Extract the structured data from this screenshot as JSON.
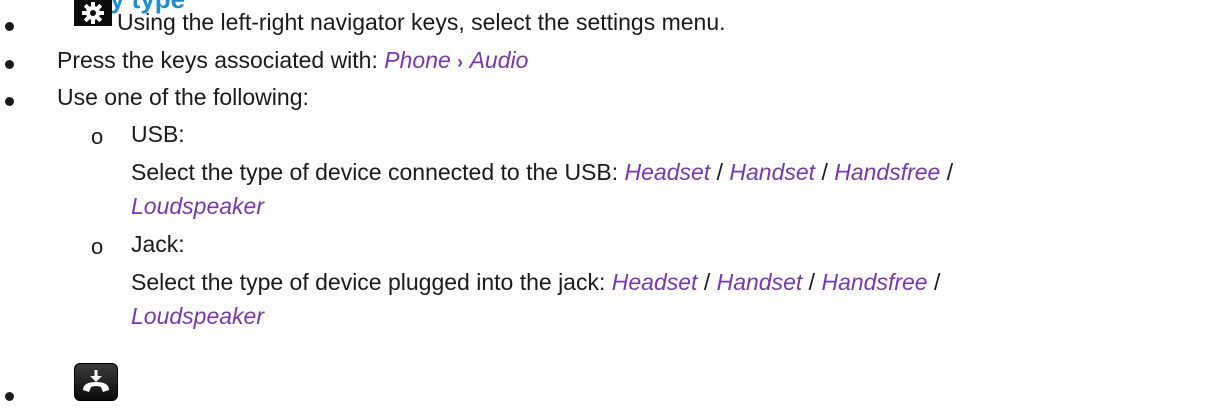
{
  "heading_fragment": "y type",
  "steps": [
    {
      "text": "Using the left-right navigator keys, select the settings menu.",
      "icon": "settings-gear-key-icon"
    },
    {
      "prefix": "Press the keys associated with:",
      "path": [
        "Phone",
        "Audio"
      ],
      "separator": "›"
    },
    {
      "text": "Use one of the following:"
    }
  ],
  "options": [
    {
      "label": "USB:",
      "description": "Select the type of device connected to the USB:",
      "devices": [
        "Headset",
        "Handset",
        "Handsfree",
        "Loudspeaker"
      ]
    },
    {
      "label": "Jack:",
      "description": "Select the type of device plugged into the jack:",
      "devices": [
        "Headset",
        "Handset",
        "Handsfree",
        "Loudspeaker"
      ]
    }
  ],
  "device_separator": "/",
  "final_step_icon": "hang-up-key-icon",
  "colors": {
    "link_purple": "#7a36b0",
    "heading_blue": "#1a8fd0",
    "text": "#1a1a1a",
    "key_background": "#0a0a0a"
  }
}
